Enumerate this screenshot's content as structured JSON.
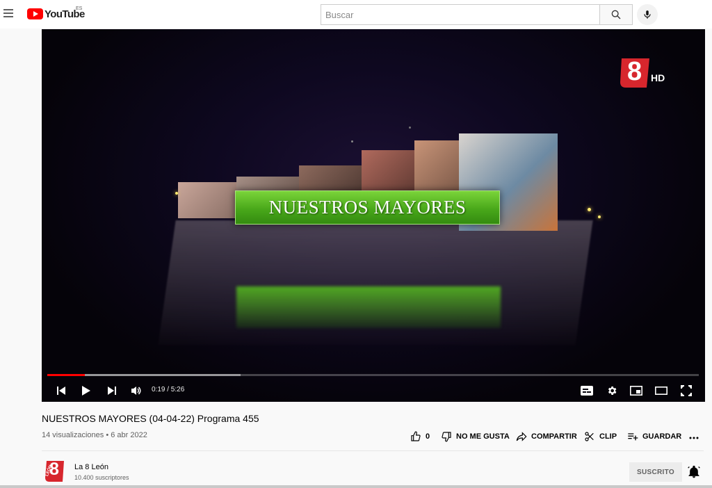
{
  "header": {
    "logo_text": "YouTube",
    "country_code": "ES",
    "search_placeholder": "Buscar",
    "icons": [
      "menu-icon",
      "search-icon",
      "microphone-icon"
    ]
  },
  "player": {
    "banner_title": "NUESTROS MAYORES",
    "channel_bug_number": "8",
    "channel_bug_suffix": "HD",
    "time_display": "0:19 / 5:26",
    "progress_fraction": 0.058,
    "buffer_fraction": 0.297,
    "controls": [
      "previous-icon",
      "play-icon",
      "next-icon",
      "volume-icon",
      "subtitles-icon",
      "settings-icon",
      "miniplayer-icon",
      "theater-icon",
      "fullscreen-icon"
    ]
  },
  "video": {
    "title": "NUESTROS MAYORES (04-04-22) Programa 455",
    "views": "14 visualizaciones",
    "date": "6 abr 2022",
    "separator": " • ",
    "actions": {
      "like_count": "0",
      "dislike": "NO ME GUSTA",
      "share": "COMPARTIR",
      "clip": "CLIP",
      "save": "GUARDAR"
    }
  },
  "channel": {
    "name": "La 8 León",
    "subscribers": "10.400 suscriptores",
    "avatar_number": "8",
    "avatar_sub": "LEÓN",
    "subscribe_label": "SUSCRITO"
  },
  "colors": {
    "brand_red": "#ff0000",
    "progress_red": "#ff0000",
    "banner_green": "#49a81a",
    "bug_red": "#d7262d"
  }
}
